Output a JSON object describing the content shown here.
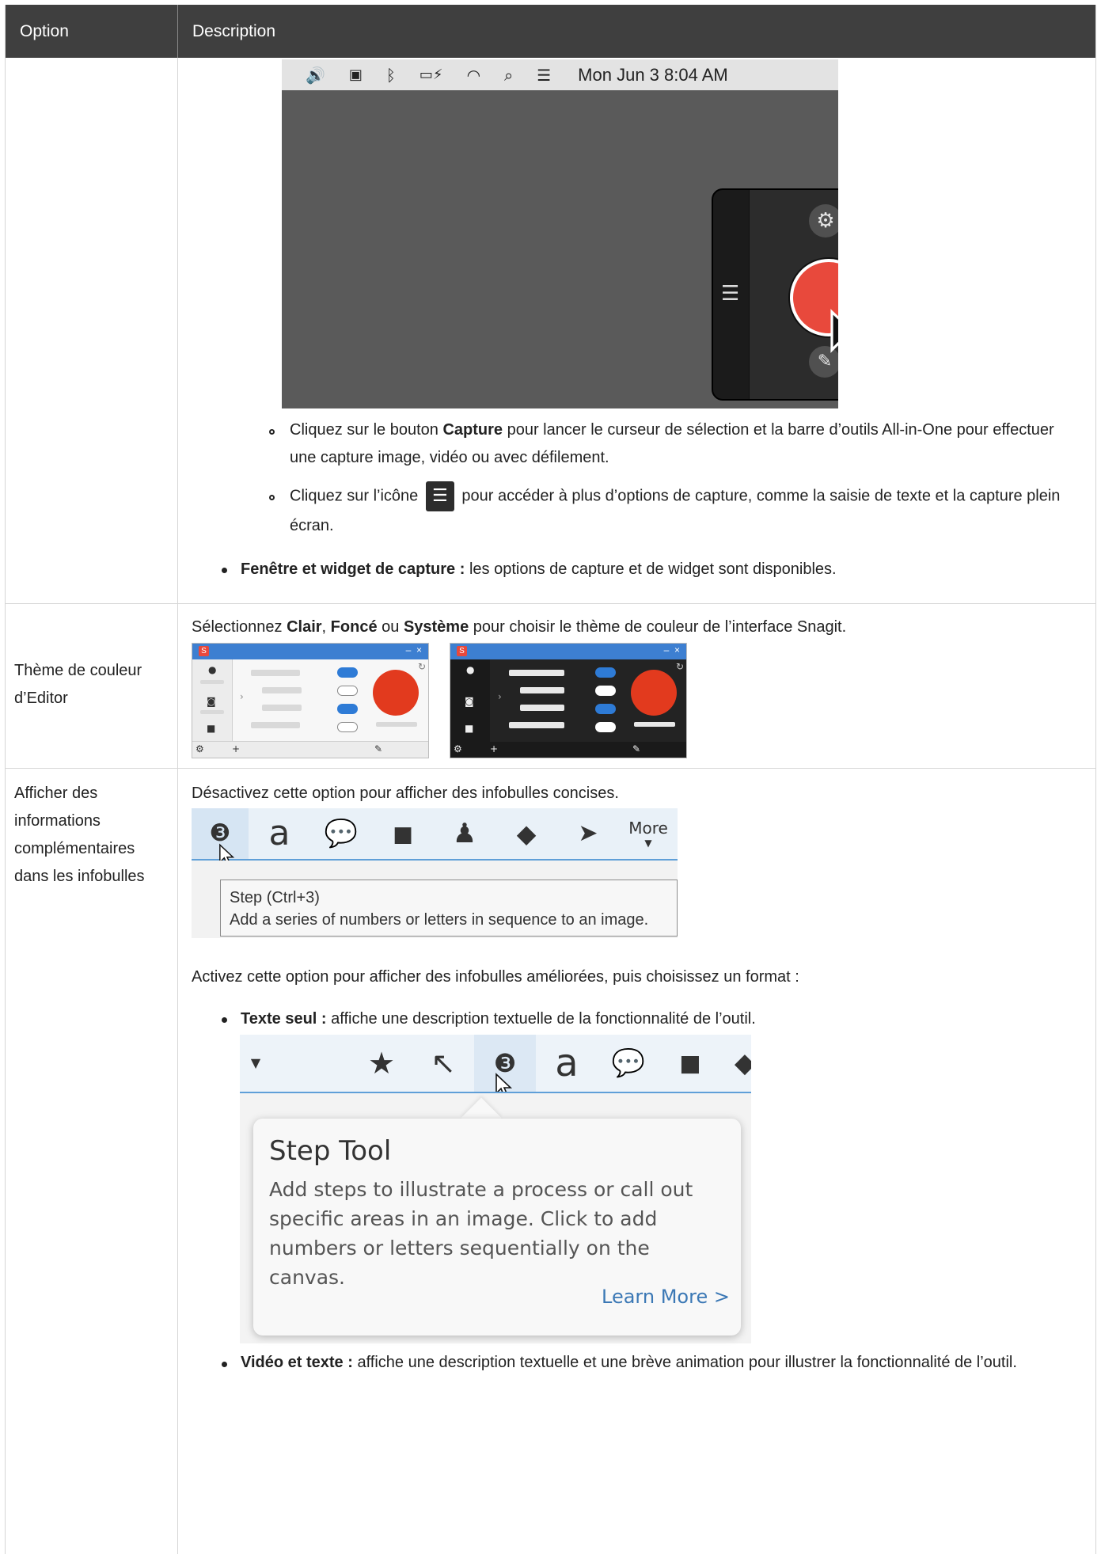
{
  "table": {
    "header": {
      "option": "Option",
      "description": "Description"
    }
  },
  "row1": {
    "menubar": {
      "clock": "Mon Jun 3  8:04 AM"
    },
    "bullet_capture": {
      "pre": "Cliquez sur le bouton ",
      "bold": "Capture",
      "post": " pour lancer le curseur de sélection et la barre d’outils All-in-One pour effectuer une capture image, vidéo ou avec défilement."
    },
    "bullet_icon": {
      "pre": "Cliquez sur l’icône",
      "post": "pour accéder à plus d’options de capture, comme la saisie de texte et la capture plein écran."
    },
    "bullet_window": {
      "bold": "Fenêtre et widget de capture :",
      "post": " les options de capture et de widget sont disponibles."
    }
  },
  "row2": {
    "option": "Thème de couleur d’Editor",
    "description": {
      "pre": "Sélectionnez ",
      "b1": "Clair",
      "m1": ", ",
      "b2": "Foncé",
      "m2": " ou ",
      "b3": "Système",
      "post": " pour choisir le thème de couleur de l’interface Snagit."
    }
  },
  "row3": {
    "option": "Afficher des informations complémentaires dans les infobulles",
    "desc_off": "Désactivez cette option pour afficher des infobulles concises.",
    "toolbar1": {
      "more_label": "More",
      "tooltip_line1": "Step (Ctrl+3)",
      "tooltip_line2": "Add a series of numbers or letters in sequence to an image."
    },
    "desc_on": "Activez cette option pour afficher des infobulles améliorées, puis choisissez un format :",
    "bullet_text": {
      "bold": "Texte seul :",
      "post": " affiche une description textuelle de la fonctionnalité de l’outil."
    },
    "tipcard": {
      "title": "Step Tool",
      "body": "Add steps to illustrate a process or call out specific areas in an image. Click to add numbers or letters sequentially on the canvas.",
      "link": "Learn More >"
    },
    "bullet_video": {
      "bold": "Vidéo et texte :",
      "post": " affiche une description textuelle et une brève animation pour illustrer la fonctionnalité de l’outil."
    }
  },
  "colors": {
    "header_bg": "#3f3f3f",
    "capture_red": "#e8493c",
    "link_blue": "#3b78b5",
    "accent_blue": "#2e7bd6"
  },
  "icons": [
    "speaker-icon",
    "battery-icon",
    "bluetooth-icon",
    "wifi-icon",
    "search-icon",
    "control-center-icon",
    "gear-icon",
    "list-icon",
    "edit-icon",
    "cursor-icon",
    "step-icon",
    "text-icon",
    "callout-icon",
    "shape-icon",
    "stamp-icon",
    "fill-icon",
    "move-icon",
    "star-icon",
    "arrow-icon"
  ]
}
